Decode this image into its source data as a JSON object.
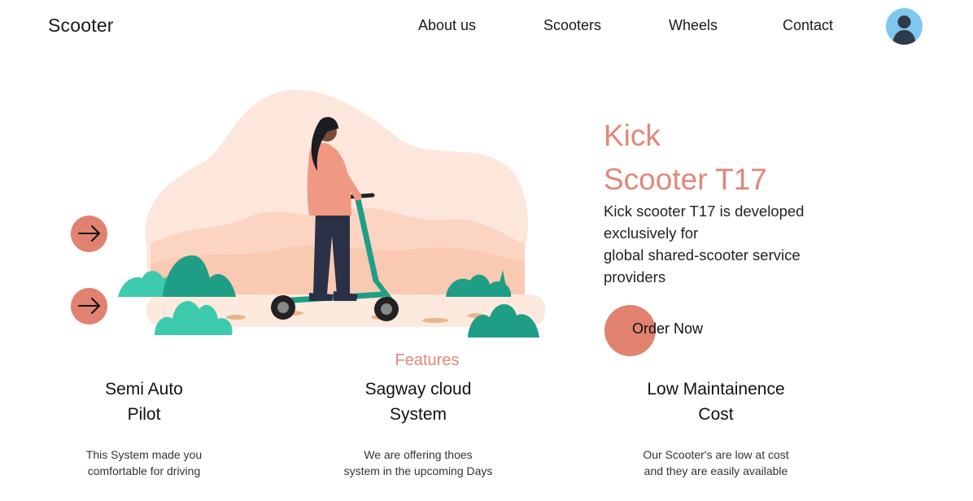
{
  "header": {
    "brand": "Scooter",
    "nav": [
      "About us",
      "Scooters",
      "Wheels",
      "Contact"
    ]
  },
  "hero": {
    "title_line1": "Kick",
    "title_line2": "Scooter T17",
    "description_lines": [
      "Kick scooter T17 is developed",
      "exclusively for",
      "global shared-scooter service",
      "providers"
    ],
    "cta": "Order Now",
    "arrow_icon": "arrow-right-icon"
  },
  "features": {
    "heading": "Features",
    "items": [
      {
        "title_lines": [
          "Semi Auto",
          "Pilot"
        ],
        "desc_lines": [
          "This System made you",
          "comfortable for driving"
        ]
      },
      {
        "title_lines": [
          "Sagway cloud",
          "System"
        ],
        "desc_lines": [
          "We are offering thoes",
          "system in the upcoming Days"
        ]
      },
      {
        "title_lines": [
          "Low Maintainence",
          "Cost"
        ],
        "desc_lines": [
          "Our Scooter's are low at cost",
          "and they are easily available"
        ]
      }
    ]
  },
  "colors": {
    "accent": "#e0826f",
    "title": "#e2877a",
    "blob": "#fde3d6",
    "teal": "#1f9e86",
    "avatar_bg": "#7ec8ef"
  }
}
